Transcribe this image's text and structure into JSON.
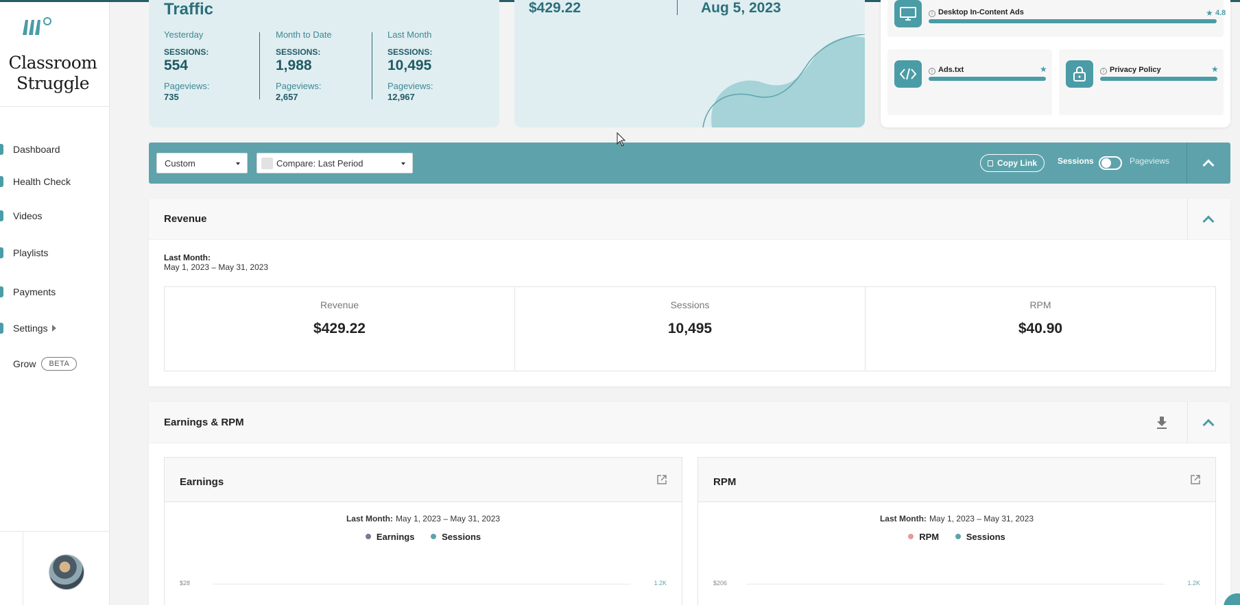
{
  "brand": {
    "name_line1": "Classroom",
    "name_line2": "Struggle"
  },
  "sidebar": {
    "items": [
      {
        "label": "Dashboard"
      },
      {
        "label": "Health Check"
      },
      {
        "label": "Videos"
      },
      {
        "label": "Playlists"
      },
      {
        "label": "Payments"
      },
      {
        "label": "Settings"
      },
      {
        "label": "Grow",
        "badge": "BETA"
      }
    ]
  },
  "traffic": {
    "title": "Traffic",
    "columns": [
      {
        "period": "Yesterday",
        "sessions_label": "SESSIONS:",
        "sessions": "554",
        "pageviews_label": "Pageviews:",
        "pageviews": "735"
      },
      {
        "period": "Month to Date",
        "sessions_label": "SESSIONS:",
        "sessions": "1,988",
        "pageviews_label": "Pageviews:",
        "pageviews": "2,657"
      },
      {
        "period": "Last Month",
        "sessions_label": "SESSIONS:",
        "sessions": "10,495",
        "pageviews_label": "Pageviews:",
        "pageviews": "12,967"
      }
    ]
  },
  "revenue_card": {
    "amount": "$429.22",
    "date": "Aug 5, 2023"
  },
  "health": {
    "items": [
      {
        "name": "Desktop In-Content Ads",
        "score": "4.8",
        "icon": "monitor-icon"
      },
      {
        "name": "Ads.txt",
        "icon": "code-icon"
      },
      {
        "name": "Privacy Policy",
        "icon": "lock-icon"
      }
    ]
  },
  "toolbar": {
    "date_select": "Custom",
    "compare_select": "Compare: Last Period",
    "copy_link": "Copy Link",
    "toggle_left": "Sessions",
    "toggle_right": "Pageviews"
  },
  "revenue_panel": {
    "title": "Revenue",
    "period_label": "Last Month:",
    "period_range": "May 1, 2023 – May 31, 2023",
    "metrics": [
      {
        "label": "Revenue",
        "value": "$429.22"
      },
      {
        "label": "Sessions",
        "value": "10,495"
      },
      {
        "label": "RPM",
        "value": "$40.90"
      }
    ]
  },
  "earnings_panel": {
    "title": "Earnings & RPM",
    "charts": [
      {
        "title": "Earnings",
        "period_label": "Last Month:",
        "period_range": "May 1, 2023 – May 31, 2023",
        "legend": [
          {
            "name": "Earnings",
            "color": "#7a7895"
          },
          {
            "name": "Sessions",
            "color": "#5ea3ab"
          }
        ],
        "y_left_top": "$28",
        "y_right_top": "1.2K"
      },
      {
        "title": "RPM",
        "period_label": "Last Month:",
        "period_range": "May 1, 2023 – May 31, 2023",
        "legend": [
          {
            "name": "RPM",
            "color": "#e39a98"
          },
          {
            "name": "Sessions",
            "color": "#5ea3ab"
          }
        ],
        "y_left_top": "$206",
        "y_right_top": "1.2K"
      }
    ]
  },
  "colors": {
    "accent": "#5ea3ab",
    "accent_dark": "#2b6f7a",
    "card_bg": "#e0eef1"
  }
}
